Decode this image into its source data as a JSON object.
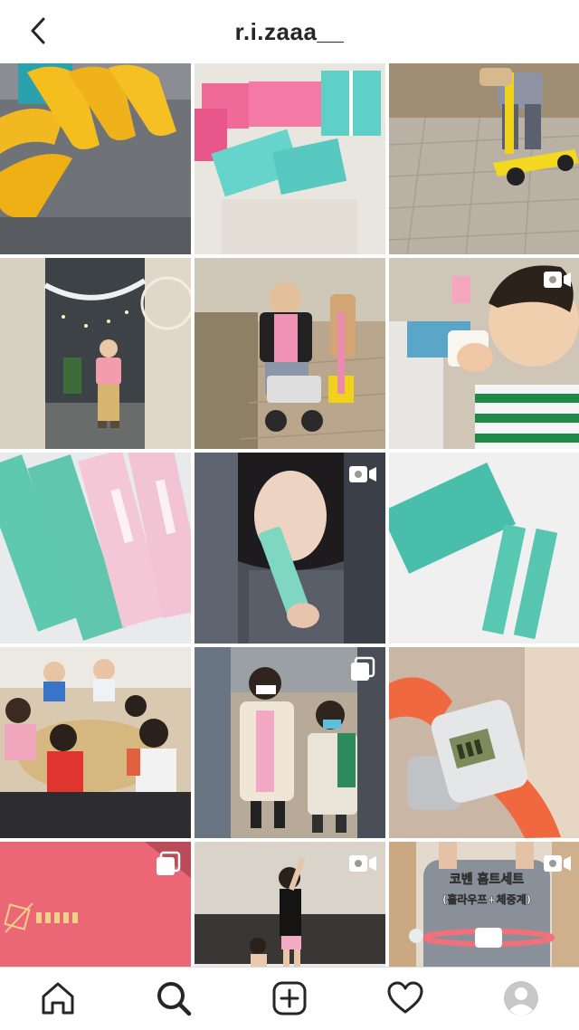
{
  "header": {
    "username": "r.i.zaaa__",
    "back_icon": "chevron-left-icon"
  },
  "grid": {
    "posts": [
      {
        "subject": "yellow hangers",
        "badge": null
      },
      {
        "subject": "pink and mint gift boxes",
        "badge": null
      },
      {
        "subject": "child on yellow scooter",
        "badge": null
      },
      {
        "subject": "child in cafe with dreamcatchers",
        "badge": null
      },
      {
        "subject": "child on ride-on toy outdoors",
        "badge": null
      },
      {
        "subject": "child drinking from pouch",
        "badge": "video-icon"
      },
      {
        "subject": "mint and pink stick pouches",
        "badge": null
      },
      {
        "subject": "woman holding mint stick",
        "badge": "video-icon"
      },
      {
        "subject": "mint box and two sticks",
        "badge": null
      },
      {
        "subject": "children at table",
        "badge": null
      },
      {
        "subject": "children with backpacks",
        "badge": "carousel-icon"
      },
      {
        "subject": "hula hoop counter",
        "badge": null
      },
      {
        "subject": "pink envelope",
        "badge": "carousel-icon"
      },
      {
        "subject": "child jumping on bed",
        "badge": "video-icon"
      },
      {
        "subject": "person with hula hoop",
        "badge": "video-icon",
        "caption_line1": "코벤 홈트세트",
        "caption_line2": "(훌라우프+체중계)"
      }
    ]
  },
  "tabbar": {
    "items": [
      "home-icon",
      "search-icon",
      "new-post-icon",
      "activity-heart-icon",
      "profile-avatar-icon"
    ],
    "active": "search-icon"
  }
}
